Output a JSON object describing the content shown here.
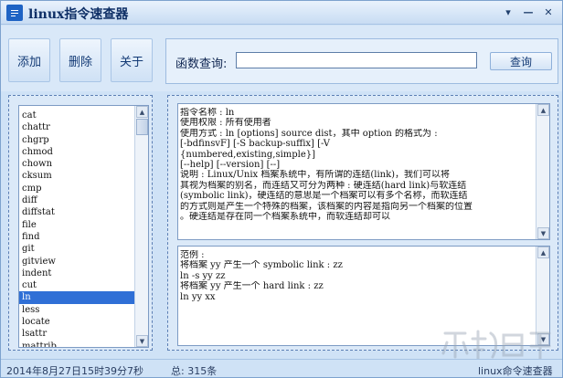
{
  "window": {
    "title": "linux指令速查器",
    "controls": [
      "▾",
      "—",
      "✕"
    ]
  },
  "toolbar": {
    "add_label": "添加",
    "delete_label": "删除",
    "about_label": "关于",
    "query_label": "函数查询:",
    "query_value": "",
    "query_button": "查询"
  },
  "commands": {
    "items": [
      "cat",
      "chattr",
      "chgrp",
      "chmod",
      "chown",
      "cksum",
      "cmp",
      "diff",
      "diffstat",
      "file",
      "find",
      "git",
      "gitview",
      "indent",
      "cut",
      "ln",
      "less",
      "locate",
      "lsattr",
      "mattrib"
    ],
    "selected": "ln"
  },
  "detail": {
    "lines": [
      "    指令名称 : ln",
      "    使用权限 : 所有使用者",
      "    使用方式 : ln [options] source dist，其中 option 的格式为 :",
      "    [-bdfinsvF] [-S backup-suffix] [-V",
      "{numbered,existing,simple}]",
      "    [--help] [--version] [--]",
      "    说明 : Linux/Unix 档案系统中，有所谓的连结(link)，我们可以将",
      "其视为档案的别名，而连结又可分为两种 : 硬连结(hard link)与软连结",
      "(symbolic link)，硬连结的意思是一个档案可以有多个名称，而软连结",
      "的方式则是产生一个特殊的档案，该档案的内容是指向另一个档案的位置",
      "。硬连结是存在同一个档案系统中，而软连结却可以"
    ]
  },
  "examples": {
    "lines": [
      "    范例 :",
      "    将档案 yy 产生一个 symbolic link : zz",
      "    ln -s yy zz",
      "    将档案 yy 产生一个 hard link : zz",
      "    ln yy xx"
    ]
  },
  "status": {
    "timestamp": "2014年8月27日15时39分7秒",
    "total": "总: 315条",
    "app_name": "linux命令速查器"
  },
  "colors": {
    "accent": "#2f6fd6",
    "window_bg": "#cfe2f6"
  }
}
